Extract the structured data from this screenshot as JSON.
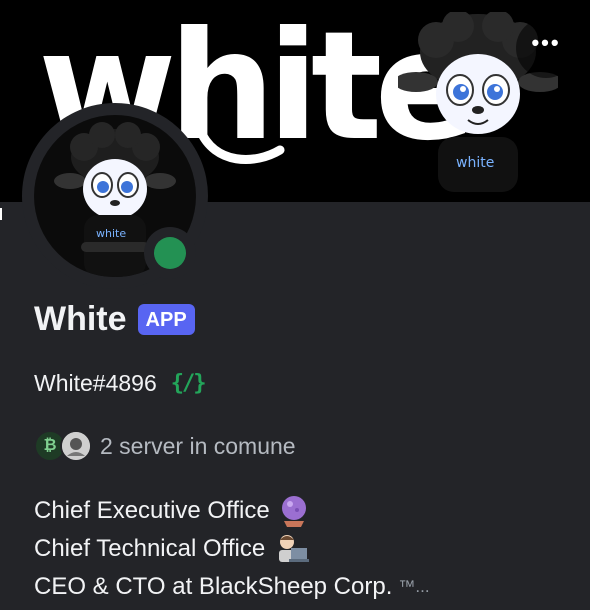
{
  "banner": {
    "word": "white",
    "more_label": "•••"
  },
  "profile": {
    "display_name": "White",
    "badge": "APP",
    "username": "White#4896",
    "command_icon": "{/}",
    "status": "online",
    "mutual_servers": "2 server in comune"
  },
  "bio": {
    "line1": "Chief Executive Office",
    "line2": "Chief Technical Office",
    "line3": "CEO & CTO at BlackSheep Corp.",
    "line3_suffix": "™...",
    "line1_icon": "crystal-ball-icon",
    "line2_icon": "technologist-icon"
  },
  "colors": {
    "accent": "#5865f2",
    "online": "#23a55a",
    "background": "#232428"
  }
}
